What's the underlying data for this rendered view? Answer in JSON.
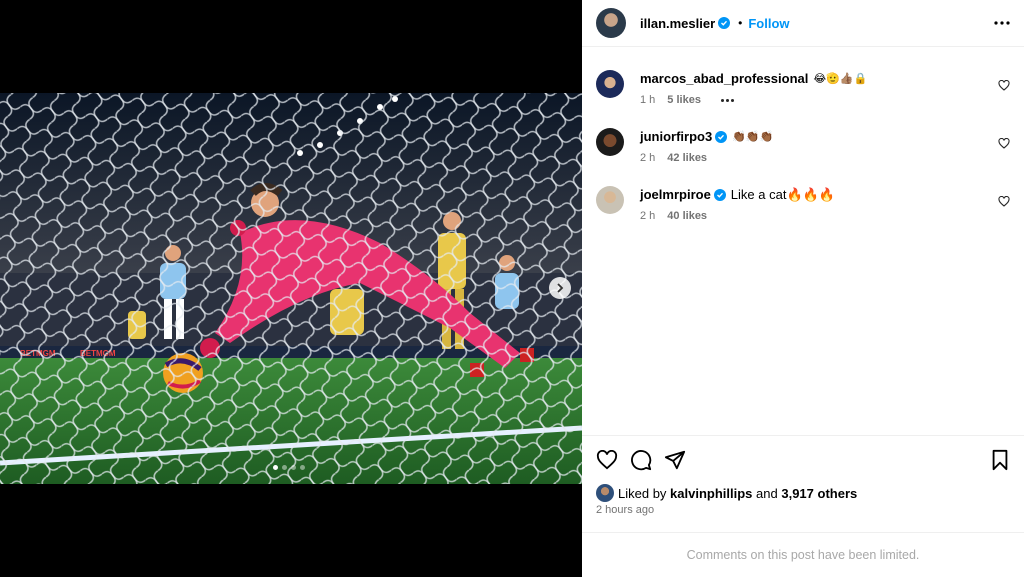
{
  "header": {
    "username": "illan.meslier",
    "separator": "•",
    "follow_label": "Follow"
  },
  "media": {
    "description_icon": "photo",
    "carousel_dots": 4,
    "active_dot": 0
  },
  "comments": [
    {
      "username": "marcos_abad_professional",
      "verified": false,
      "text": "😂🫡👍🏽🔒",
      "time": "1 h",
      "likes": "5 likes",
      "has_more": true
    },
    {
      "username": "juniorfirpo3",
      "verified": true,
      "text": "👏🏾👏🏾👏🏾",
      "time": "2 h",
      "likes": "42 likes",
      "has_more": false
    },
    {
      "username": "joelmrpiroe",
      "verified": true,
      "text": "Like a cat🔥🔥🔥",
      "time": "2 h",
      "likes": "40 likes",
      "has_more": false
    }
  ],
  "likes": {
    "prefix": "Liked by",
    "user": "kalvinphillips",
    "and": "and",
    "others": "3,917 others"
  },
  "time_ago": "2 hours ago",
  "limited_text": "Comments on this post have been limited.",
  "colors": {
    "accent": "#0095f6",
    "secondary_text": "#737373",
    "pitch": "#2e7d32",
    "keeper_kit": "#e8336f"
  }
}
